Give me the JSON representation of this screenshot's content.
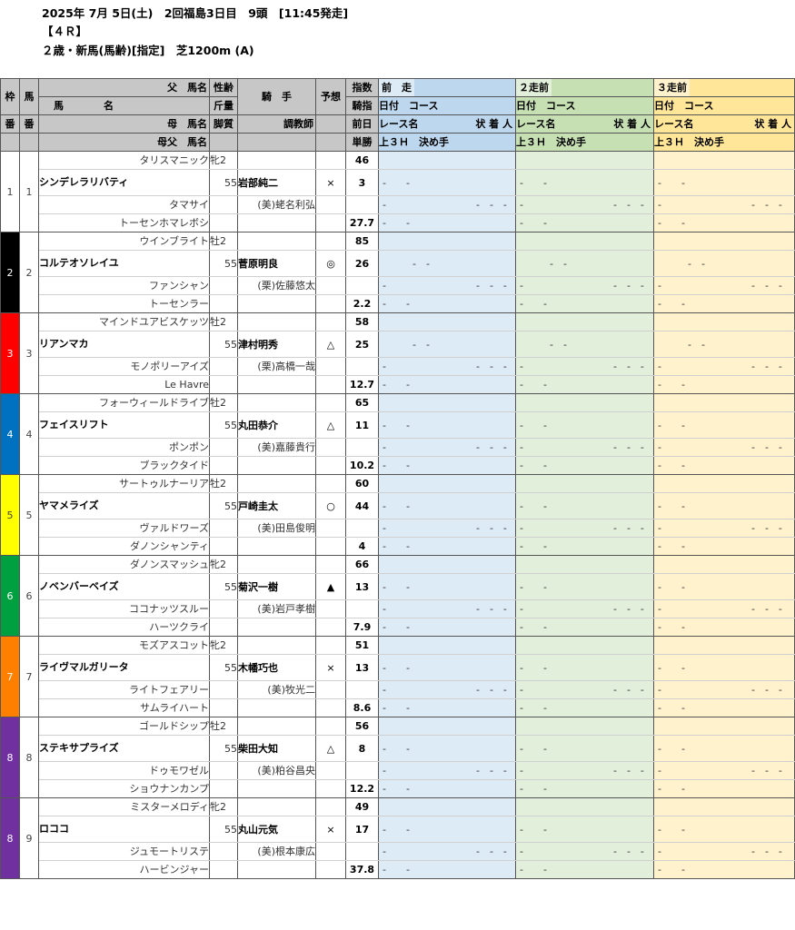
{
  "header": {
    "line1": "2025年 7月 5日(土)　2回福島3日目　9頭　[11:45発走]",
    "line2": "【４Ｒ】",
    "line3": "２歳・新馬(馬齢)[指定]　芝1200m (A)"
  },
  "columns": {
    "waku": [
      "枠",
      "番"
    ],
    "uma": [
      "馬",
      "番"
    ],
    "chichi": "父　馬名",
    "horse_left": "馬",
    "horse_right": "名",
    "haha": "母　馬名",
    "hahachichi": "母父　馬名",
    "seirei": "性齢",
    "kinryo": "斤量",
    "kyakushitsu": "脚質",
    "kishu_a": "騎",
    "kishu_b": "手",
    "chokyoshi": "調教師",
    "yoso": "予想",
    "shisu": "指数",
    "kishi": "騎指",
    "zenjitsu": "前日",
    "tansho": "単勝",
    "past": [
      {
        "title": "前　走",
        "sub1": "日付　コース",
        "sub2": "レース名",
        "sub2r": "状 着 人",
        "sub3": "上３Ｈ　決め手",
        "color": "#bdd7ee",
        "body": "#ddebf7"
      },
      {
        "title": "２走前",
        "sub1": "日付　コース",
        "sub2": "レース名",
        "sub2r": "状 着 人",
        "sub3": "上３Ｈ　決め手",
        "color": "#c6e0b4",
        "body": "#e2efda"
      },
      {
        "title": "３走前",
        "sub1": "日付　コース",
        "sub2": "レース名",
        "sub2r": "状 着 人",
        "sub3": "上３Ｈ　決め手",
        "color": "#ffe699",
        "body": "#fff2cc"
      }
    ]
  },
  "horses": [
    {
      "waku": "1",
      "uma": "1",
      "waku_color": "#ffffff",
      "waku_text": "#444444",
      "sire": "タリスマニック",
      "sexage": "牝2",
      "name": "シンデレラリバティ",
      "weight": "55",
      "jockey": "岩部純二",
      "yoso": "×",
      "idx": "46",
      "kishi": "3",
      "dam": "タマサイ",
      "trainer": "(美)蛯名利弘",
      "damsire": "トーセンホマレボシ",
      "odds": "27.7",
      "p1": "-　　-",
      "p2": "",
      "p3": "-　　　　　　　　　-　-　-",
      "p4": "-　　-"
    },
    {
      "waku": "2",
      "uma": "2",
      "waku_color": "#000000",
      "waku_text": "#ffffff",
      "sire": "ウインブライト",
      "sexage": "牡2",
      "name": "コルテオソレイユ",
      "weight": "55",
      "jockey": "菅原明良",
      "yoso": "◎",
      "idx": "85",
      "kishi": "26",
      "dam": "ファンシャン",
      "trainer": "(栗)佐藤悠太",
      "damsire": "トーセンラー",
      "odds": "2.2",
      "p1": "",
      "p2": "　　　-　-",
      "p3": "-　　　　　　　　　-　-　-",
      "p4": "-　　-"
    },
    {
      "waku": "3",
      "uma": "3",
      "waku_color": "#ff0000",
      "waku_text": "#ffffff",
      "sire": "マインドユアビスケッツ",
      "sexage": "牡2",
      "name": "リアンマカ",
      "weight": "55",
      "jockey": "津村明秀",
      "yoso": "△",
      "idx": "58",
      "kishi": "25",
      "dam": "モノポリーアイズ",
      "trainer": "(栗)高橋一哉",
      "damsire": "Le Havre",
      "odds": "12.7",
      "p1": "",
      "p2": "　　　-　-",
      "p3": "-　　　　　　　　　-　-　-",
      "p4": "-　　-"
    },
    {
      "waku": "4",
      "uma": "4",
      "waku_color": "#0070c0",
      "waku_text": "#ffffff",
      "sire": "フォーウィールドライブ",
      "sexage": "牡2",
      "name": "フェイスリフト",
      "weight": "55",
      "jockey": "丸田恭介",
      "yoso": "△",
      "idx": "65",
      "kishi": "11",
      "dam": "ポンポン",
      "trainer": "(美)嘉藤貴行",
      "damsire": "ブラックタイド",
      "odds": "10.2",
      "p1": "-　　-",
      "p2": "",
      "p3": "-　　　　　　　　　-　-　-",
      "p4": "-　　-"
    },
    {
      "waku": "5",
      "uma": "5",
      "waku_color": "#ffff00",
      "waku_text": "#444444",
      "sire": "サートゥルナーリア",
      "sexage": "牡2",
      "name": "ヤマメライズ",
      "weight": "55",
      "jockey": "戸崎圭太",
      "yoso": "○",
      "idx": "60",
      "kishi": "44",
      "dam": "ヴァルドワーズ",
      "trainer": "(美)田島俊明",
      "damsire": "ダノンシャンティ",
      "odds": "4",
      "p1": "-　　-",
      "p2": "",
      "p3": "-　　　　　　　　　-　-　-",
      "p4": "-　　-"
    },
    {
      "waku": "6",
      "uma": "6",
      "waku_color": "#00a040",
      "waku_text": "#ffffff",
      "sire": "ダノンスマッシュ",
      "sexage": "牝2",
      "name": "ノベンバーベイズ",
      "weight": "55",
      "jockey": "菊沢一樹",
      "yoso": "▲",
      "idx": "66",
      "kishi": "13",
      "dam": "ココナッツスルー",
      "trainer": "(美)岩戸孝樹",
      "damsire": "ハーツクライ",
      "odds": "7.9",
      "p1": "-　　-",
      "p2": "",
      "p3": "-　　　　　　　　　-　-　-",
      "p4": "-　　-"
    },
    {
      "waku": "7",
      "uma": "7",
      "waku_color": "#ff8000",
      "waku_text": "#ffffff",
      "sire": "モズアスコット",
      "sexage": "牝2",
      "name": "ライヴマルガリータ",
      "weight": "55",
      "jockey": "木幡巧也",
      "yoso": "×",
      "idx": "51",
      "kishi": "13",
      "dam": "ライトフェアリー",
      "trainer": "(美)牧光二",
      "damsire": "サムライハート",
      "odds": "8.6",
      "p1": "-　　-",
      "p2": "",
      "p3": "-　　　　　　　　　-　-　-",
      "p4": "-　　-"
    },
    {
      "waku": "8",
      "uma": "8",
      "waku_color": "#7030a0",
      "waku_text": "#ffffff",
      "sire": "ゴールドシップ",
      "sexage": "牡2",
      "name": "ステキサプライズ",
      "weight": "55",
      "jockey": "柴田大知",
      "yoso": "△",
      "idx": "56",
      "kishi": "8",
      "dam": "ドゥモワゼル",
      "trainer": "(美)粕谷昌央",
      "damsire": "ショウナンカンプ",
      "odds": "12.2",
      "p1": "-　　-",
      "p2": "",
      "p3": "-　　　　　　　　　-　-　-",
      "p4": "-　　-"
    },
    {
      "waku": "8",
      "uma": "9",
      "waku_color": "#7030a0",
      "waku_text": "#ffffff",
      "sire": "ミスターメロディ",
      "sexage": "牝2",
      "name": "ロココ",
      "weight": "55",
      "jockey": "丸山元気",
      "yoso": "×",
      "idx": "49",
      "kishi": "17",
      "dam": "ジュモートリステ",
      "trainer": "(美)根本康広",
      "damsire": "ハービンジャー",
      "odds": "37.8",
      "p1": "-　　-",
      "p2": "",
      "p3": "-　　　　　　　　　-　-　-",
      "p4": "-　　-"
    }
  ]
}
